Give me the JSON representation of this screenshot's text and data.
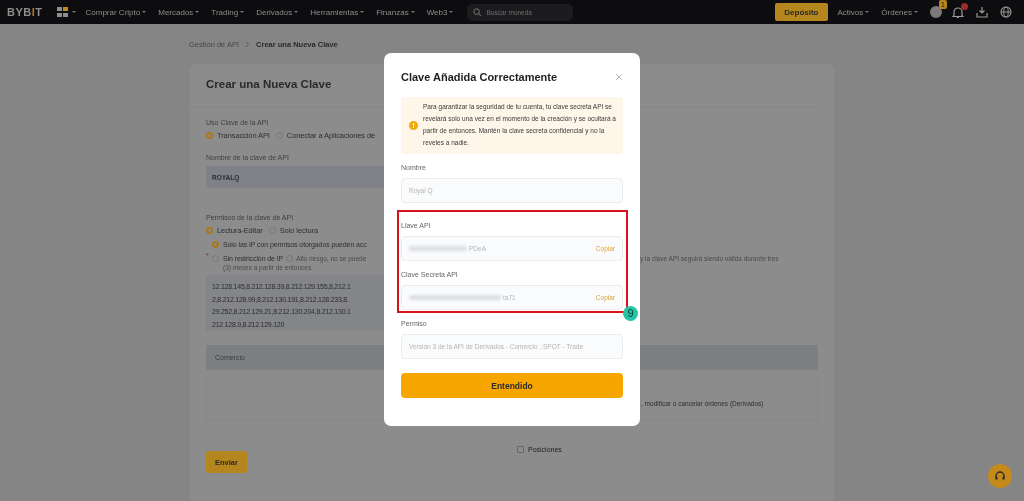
{
  "nav": {
    "logo": [
      "BYB",
      "I",
      "T"
    ],
    "items": [
      "Comprar Cripto",
      "Mercados",
      "Trading",
      "Derivados",
      "Herramientas",
      "Finanzas",
      "Web3"
    ],
    "search": {
      "placeholder": "Buscar moneda"
    },
    "deposit": "Depósito",
    "right_items": [
      "Activos",
      "Órdenes"
    ],
    "avatar_badge": "1"
  },
  "breadcrumb": [
    {
      "label": "Gestión de API",
      "selected": false
    },
    {
      "label": "Crear una Nueva Clave",
      "selected": true
    }
  ],
  "card": {
    "title": "Crear una Nueva Clave",
    "usage": {
      "label": "Uso Clave de la API",
      "options": [
        {
          "label": "Transacción API",
          "selected": true
        },
        {
          "label": "Conectar a Aplicaciones de",
          "selected": false
        }
      ]
    },
    "name_field": {
      "label": "Nombre de la clave de API",
      "value": "ROYALQ"
    },
    "permissions": {
      "label": "Permisos de la clave de API",
      "options": [
        {
          "label": "Lectura-Editar",
          "selected": true
        },
        {
          "label": "Solo lectura",
          "selected": false
        }
      ]
    },
    "ip_options": [
      {
        "label": "Solo las IP con permisos otorgados pueden acc",
        "selected": true
      },
      {
        "label": "Sin restricción de IP",
        "selected": false,
        "required_mark": "*",
        "note": "Alto riesgo, no se puede",
        "note_right": "y la clave API seguirá siendo válida durante tres"
      }
    ],
    "ip_note_line2": "(3) meses a partir de entonces.",
    "ip_list": [
      "12.128.145,8.212.128.39,8.212.129.155,8.212.1",
      "2,8.212.128.99,8.212.130.191,8.212.128.233,8.",
      "29.252,8.212.129.21,8.212.130.204,8.212.130.1",
      "212.128.9,8.212.129.120"
    ],
    "table": {
      "header": "Comercio",
      "row_text": ", modificar o cancelar órdenes (Derivados)",
      "checkbox_label": "Posiciones",
      "checkbox_checked": false
    },
    "submit": "Enviar"
  },
  "modal": {
    "title": "Clave Añadida Correctamente",
    "notice": "Para garantizar la seguridad de tu cuenta, tu clave secreta API se revelará solo una vez en el momento de la creación y se ocultará a partir de entonces. Mantén la clave secreta confidencial y no la reveles a nadie.",
    "fields": [
      {
        "kind": "plain",
        "label": "Nombre",
        "value": "Royal Q"
      },
      {
        "kind": "secret",
        "label": "Llave API",
        "value": "PDeA",
        "action": "Copiar"
      },
      {
        "kind": "secret",
        "label": "Clave Secreta API",
        "value": "ta71",
        "action": "Copiar"
      },
      {
        "kind": "plain",
        "label": "Permiso",
        "value": "Versión 3 de la API de Derivados - Comercio , SPOT - Trade"
      }
    ],
    "button": "Entendido"
  },
  "annotation": {
    "label": "9"
  }
}
